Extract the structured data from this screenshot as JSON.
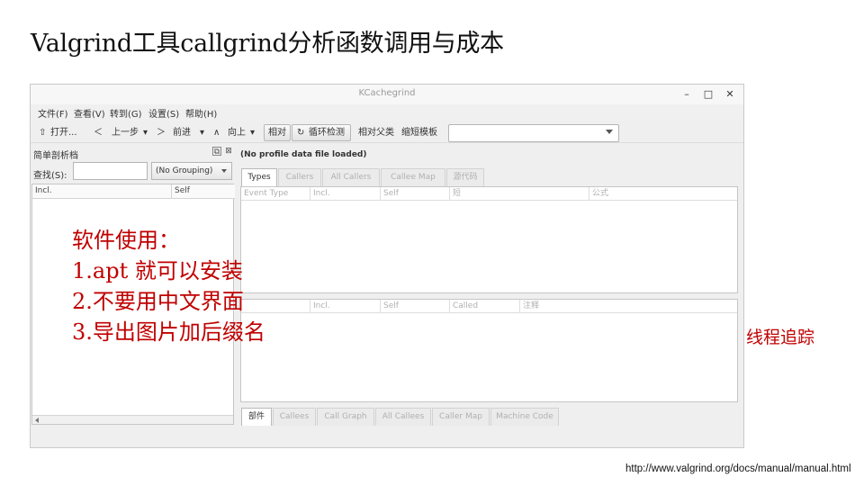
{
  "slide": {
    "title": "Valgrind工具callgrind分析函数调用与成本",
    "notes": {
      "heading": "软件使用：",
      "items": [
        "1.apt 就可以安装",
        "2.不要用中文界面",
        "3.导出图片加后缀名"
      ]
    },
    "side_note": "线程追踪",
    "source_link": "http://www.valgrind.org/docs/manual/manual.html"
  },
  "window": {
    "title": "KCachegrind",
    "controls": [
      "–",
      "□",
      "✕"
    ]
  },
  "menubar": [
    "文件(F)",
    "查看(V)",
    "转到(G)",
    "设置(S)",
    "帮助(H)"
  ],
  "toolbar": {
    "open": "打开...",
    "back": "上一步",
    "forward": "前进",
    "up": "向上",
    "relative": "相对",
    "cycle_detection": "循环检测",
    "relative_to_parent": "相对父类",
    "shorten_templates": "缩短模板",
    "event_type_select": ""
  },
  "flat_profile": {
    "title": "简单剖析档",
    "search_label": "查找(S):",
    "search_value": "",
    "grouping": "(No Grouping)",
    "columns": [
      "Incl.",
      "Self"
    ]
  },
  "main_panel": {
    "status": "(No profile data file loaded)",
    "top_tabs": [
      "Types",
      "Callers",
      "All Callers",
      "Callee Map",
      "源代码"
    ],
    "top_columns": [
      "Event Type",
      "Incl.",
      "Self",
      "短",
      "公式"
    ],
    "bottom_columns": [
      "Incl.",
      "Self",
      "Called",
      "注释"
    ],
    "bottom_tabs": [
      "部件",
      "Callees",
      "Call Graph",
      "All Callees",
      "Caller Map",
      "Machine Code"
    ]
  },
  "colors": {
    "note_red": "#c00000",
    "window_bg": "#efefef"
  }
}
